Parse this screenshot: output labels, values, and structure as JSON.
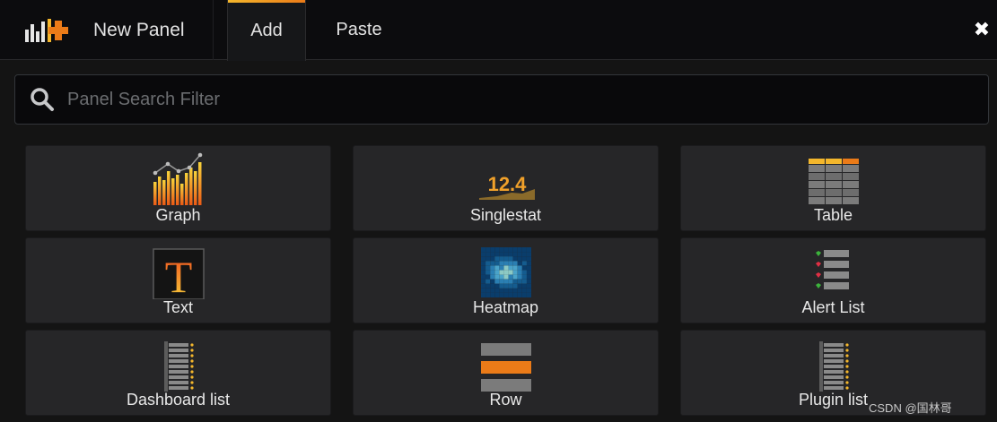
{
  "header": {
    "brand_label": "New Panel",
    "tabs": [
      {
        "label": "Add",
        "active": true
      },
      {
        "label": "Paste",
        "active": false
      }
    ],
    "close_glyph": "✖"
  },
  "search": {
    "placeholder": "Panel Search Filter",
    "value": ""
  },
  "panels": [
    {
      "label": "Graph",
      "icon": "graph-icon"
    },
    {
      "label": "Singlestat",
      "icon": "singlestat-icon",
      "icon_text": "12.4"
    },
    {
      "label": "Table",
      "icon": "table-icon"
    },
    {
      "label": "Text",
      "icon": "text-icon",
      "icon_text": "T"
    },
    {
      "label": "Heatmap",
      "icon": "heatmap-icon"
    },
    {
      "label": "Alert List",
      "icon": "alert-list-icon"
    },
    {
      "label": "Dashboard list",
      "icon": "dashboard-list-icon"
    },
    {
      "label": "Row",
      "icon": "row-icon"
    },
    {
      "label": "Plugin list",
      "icon": "plugin-list-icon"
    }
  ],
  "watermark": "CSDN @国林哥",
  "colors": {
    "accent_orange": "#eb7b18",
    "accent_yellow": "#f4b72c",
    "card_bg": "#262628",
    "page_bg": "#141414"
  }
}
